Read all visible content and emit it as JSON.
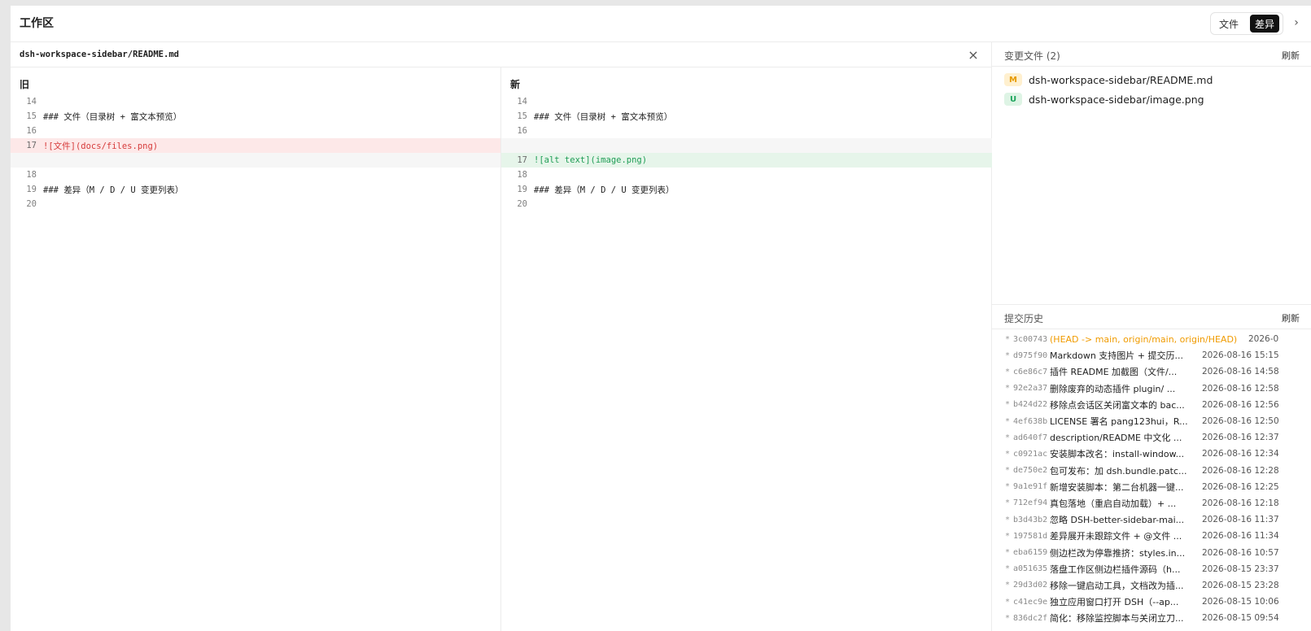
{
  "header": {
    "title": "工作区",
    "toggle_files": "文件",
    "toggle_diff": "差异",
    "collapse_glyph": "›"
  },
  "diff": {
    "file_path": "dsh-workspace-sidebar/README.md",
    "close_glyph": "×",
    "old_title": "旧",
    "new_title": "新",
    "old_lines": [
      {
        "no": "14",
        "text": "",
        "type": "context"
      },
      {
        "no": "15",
        "text": "### 文件（目录树 + 富文本预览）",
        "type": "context"
      },
      {
        "no": "16",
        "text": "",
        "type": "context"
      },
      {
        "no": "17",
        "text": "![文件](docs/files.png)",
        "type": "removed"
      },
      {
        "no": "",
        "text": "",
        "type": "empty"
      },
      {
        "no": "18",
        "text": "",
        "type": "context"
      },
      {
        "no": "19",
        "text": "### 差异（M / D / U 变更列表）",
        "type": "context"
      },
      {
        "no": "20",
        "text": "",
        "type": "context"
      }
    ],
    "new_lines": [
      {
        "no": "14",
        "text": "",
        "type": "context"
      },
      {
        "no": "15",
        "text": "### 文件（目录树 + 富文本预览）",
        "type": "context"
      },
      {
        "no": "16",
        "text": "",
        "type": "context"
      },
      {
        "no": "",
        "text": "",
        "type": "empty"
      },
      {
        "no": "17",
        "text": "![alt text](image.png)",
        "type": "added"
      },
      {
        "no": "18",
        "text": "",
        "type": "context"
      },
      {
        "no": "19",
        "text": "### 差异（M / D / U 变更列表）",
        "type": "context"
      },
      {
        "no": "20",
        "text": "",
        "type": "context"
      }
    ]
  },
  "changes": {
    "title": "变更文件 (2)",
    "refresh": "刷新",
    "items": [
      {
        "status": "M",
        "path": "dsh-workspace-sidebar/README.md"
      },
      {
        "status": "U",
        "path": "dsh-workspace-sidebar/image.png"
      }
    ]
  },
  "history": {
    "title": "提交历史",
    "refresh": "刷新",
    "commits": [
      {
        "star": "*",
        "hash": "3c00743",
        "message": "(HEAD -> main, origin/main, origin/HEAD)",
        "time": "2026-0",
        "head": true
      },
      {
        "star": "*",
        "hash": "d975f90",
        "message": "Markdown 支持图片 + 提交历...",
        "time": "2026-08-16 15:15",
        "head": false
      },
      {
        "star": "*",
        "hash": "c6e86c7",
        "message": "插件 README 加截图（文件/...",
        "time": "2026-08-16 14:58",
        "head": false
      },
      {
        "star": "*",
        "hash": "92e2a37",
        "message": "删除废弃的动态插件 plugin/ ...",
        "time": "2026-08-16 12:58",
        "head": false
      },
      {
        "star": "*",
        "hash": "b424d22",
        "message": "移除点会话区关闭富文本的 bac...",
        "time": "2026-08-16 12:56",
        "head": false
      },
      {
        "star": "*",
        "hash": "4ef638b",
        "message": "LICENSE 署名 pang123hui，R...",
        "time": "2026-08-16 12:50",
        "head": false
      },
      {
        "star": "*",
        "hash": "ad640f7",
        "message": "description/README 中文化 ...",
        "time": "2026-08-16 12:37",
        "head": false
      },
      {
        "star": "*",
        "hash": "c0921ac",
        "message": "安装脚本改名：install-window...",
        "time": "2026-08-16 12:34",
        "head": false
      },
      {
        "star": "*",
        "hash": "de750e2",
        "message": "包可发布：加 dsh.bundle.patc...",
        "time": "2026-08-16 12:28",
        "head": false
      },
      {
        "star": "*",
        "hash": "9a1e91f",
        "message": "新增安装脚本：第二台机器一键...",
        "time": "2026-08-16 12:25",
        "head": false
      },
      {
        "star": "*",
        "hash": "712ef94",
        "message": "真包落地（重启自动加载）+ ...",
        "time": "2026-08-16 12:18",
        "head": false
      },
      {
        "star": "*",
        "hash": "b3d43b2",
        "message": "忽略 DSH-better-sidebar-mai...",
        "time": "2026-08-16 11:37",
        "head": false
      },
      {
        "star": "*",
        "hash": "197581d",
        "message": "差异展开未跟踪文件 + @文件 ...",
        "time": "2026-08-16 11:34",
        "head": false
      },
      {
        "star": "*",
        "hash": "eba6159",
        "message": "侧边栏改为停靠推挤：styles.in...",
        "time": "2026-08-16 10:57",
        "head": false
      },
      {
        "star": "*",
        "hash": "a051635",
        "message": "落盘工作区侧边栏插件源码（h...",
        "time": "2026-08-15 23:37",
        "head": false
      },
      {
        "star": "*",
        "hash": "29d3d02",
        "message": "移除一键启动工具，文档改为插...",
        "time": "2026-08-15 23:28",
        "head": false
      },
      {
        "star": "*",
        "hash": "c41ec9e",
        "message": "独立应用窗口打开 DSH（--ap...",
        "time": "2026-08-15 10:06",
        "head": false
      },
      {
        "star": "*",
        "hash": "836dc2f",
        "message": "简化：移除监控脚本与关闭立刀...",
        "time": "2026-08-15 09:54",
        "head": false
      }
    ]
  },
  "colors": {
    "accent": "#111111",
    "removed_bg": "#fde8e8",
    "removed_text": "#d63b3b",
    "added_bg": "#e6f5ea",
    "added_text": "#1f9d55",
    "head_ref": "#f09b00"
  }
}
